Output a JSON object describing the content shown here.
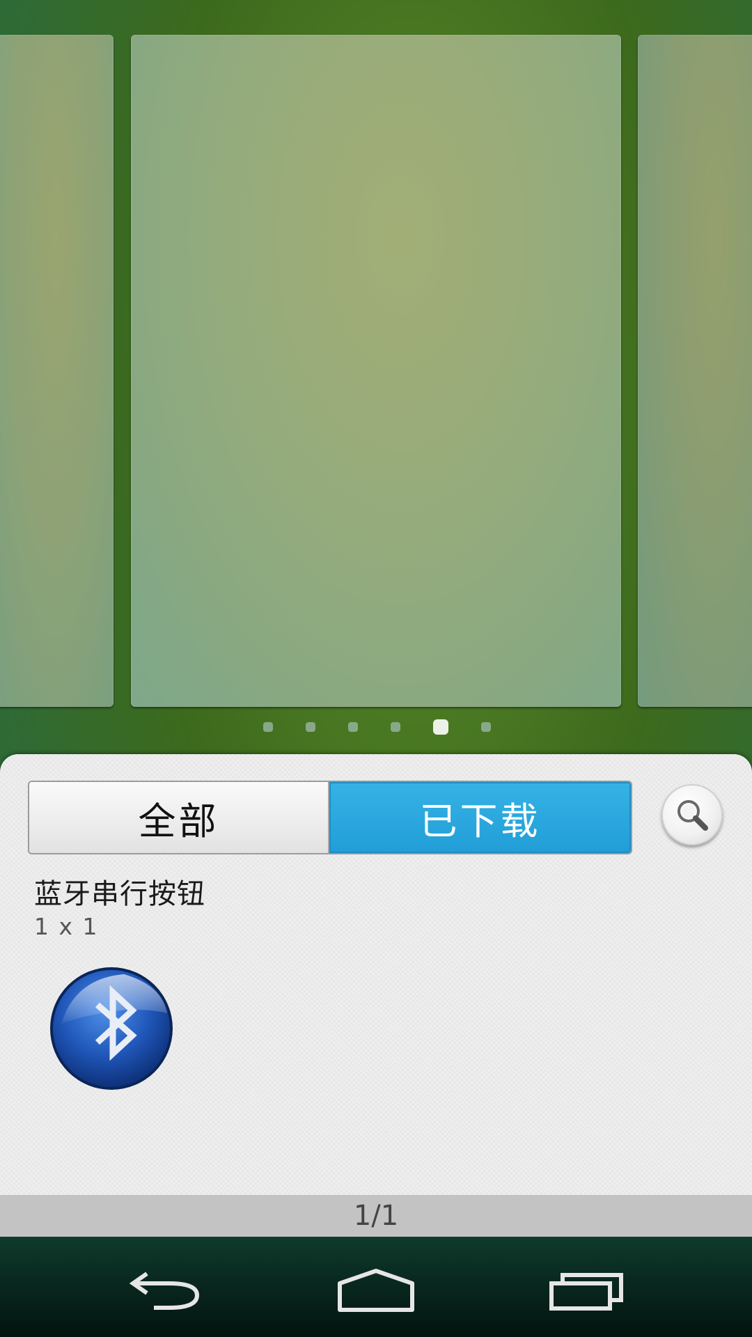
{
  "pager_dots": {
    "count": 6,
    "active_index": 4
  },
  "tabs": [
    {
      "label": "全部",
      "selected": false
    },
    {
      "label": "已下载",
      "selected": true
    }
  ],
  "search": {
    "icon": "search-icon"
  },
  "widget": {
    "title": "蓝牙串行按钮",
    "size": "1 x 1",
    "icon": "bluetooth-icon"
  },
  "pagination": {
    "text": "1/1"
  },
  "navigation": {
    "back_icon": "back-icon",
    "home_icon": "home-icon",
    "recent_icon": "recent-apps-icon"
  },
  "colors": {
    "accent": "#2aa8df",
    "drawer_bg": "#efefef",
    "pager_bar": "#c3c3c3"
  }
}
